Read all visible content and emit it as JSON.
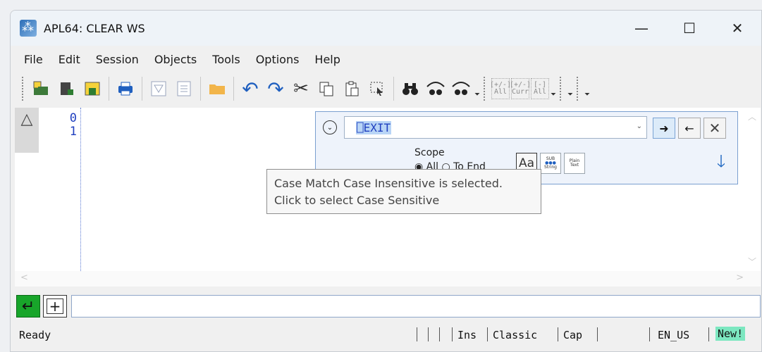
{
  "window": {
    "title": "APL64: CLEAR WS",
    "controls": [
      "—",
      "☐",
      "✕"
    ]
  },
  "menu": [
    "File",
    "Edit",
    "Session",
    "Objects",
    "Tools",
    "Options",
    "Help"
  ],
  "toolbar": {
    "bracket_all": "[+/-]",
    "bracket_all_sub": "All",
    "bracket_curr": "[+/-]",
    "bracket_curr_sub": "Curr",
    "bracket_minus": "[-]",
    "bracket_minus_sub": "All"
  },
  "session": {
    "line_numbers": [
      "0",
      "1"
    ]
  },
  "find": {
    "value": "⎕EXIT",
    "scope_label": "Scope",
    "scope_options": "◉ All  ○ To End",
    "case_button": "Aa",
    "sub_button": "SUB",
    "sub_button_sub": "String",
    "plain_button": "Plain",
    "plain_button_sub": "Text"
  },
  "tooltip": {
    "line1": "Case Match Case Insensitive is selected.",
    "line2": "Click to select Case Sensitive"
  },
  "input": {
    "value": ""
  },
  "status": {
    "ready": "Ready",
    "ins": "Ins",
    "mode": "Classic",
    "cap": "Cap",
    "locale": "EN_US",
    "new": "New!"
  }
}
